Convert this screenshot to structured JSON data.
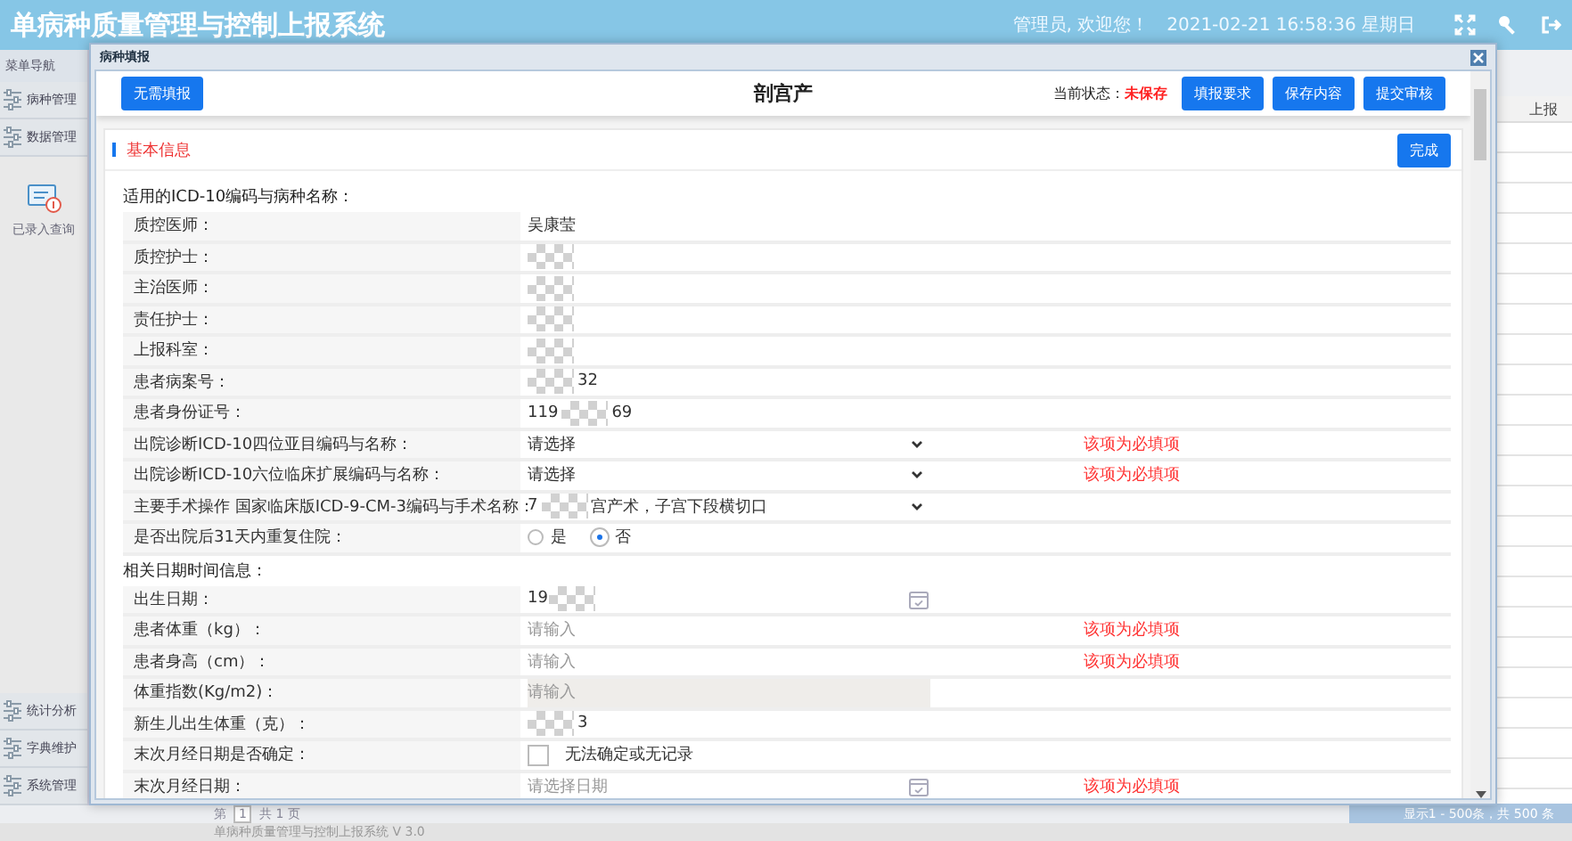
{
  "header": {
    "title": "单病种质量管理与控制上报系统",
    "welcome": "管理员, 欢迎您！",
    "datetime": "2021-02-21 16:58:36 星期日"
  },
  "sidebar": {
    "title": "菜单导航",
    "items": [
      {
        "label": "病种管理"
      },
      {
        "label": "数据管理"
      }
    ],
    "shortcut": {
      "label": "已录入查询"
    },
    "bottom_items": [
      {
        "label": "统计分析"
      },
      {
        "label": "字典维护"
      },
      {
        "label": "系统管理"
      }
    ]
  },
  "background_table": {
    "column_header": "上报"
  },
  "pager": {
    "page_label": "第",
    "page": "1",
    "total": "共 1 页",
    "summary": "显示1 - 500条，共 500 条"
  },
  "footer": "单病种质量管理与控制上报系统  V 3.0",
  "dialog": {
    "title": "病种填报",
    "toolbar": {
      "left_button": "无需填报",
      "heading": "剖宫产",
      "status_label": "当前状态：",
      "status": "未保存",
      "buttons": [
        "填报要求",
        "保存内容",
        "提交审核"
      ]
    },
    "section": {
      "title": "基本信息",
      "done_button": "完成"
    },
    "groups": [
      {
        "caption": "适用的ICD-10编码与病种名称：",
        "rows": [
          {
            "kind": "text",
            "label": "质控医师：",
            "value": "吴康莹"
          },
          {
            "kind": "text",
            "label": "质控护士：",
            "redacted": true
          },
          {
            "kind": "text",
            "label": "主治医师：",
            "redacted": true
          },
          {
            "kind": "text",
            "label": "责任护士：",
            "redacted": true
          },
          {
            "kind": "text",
            "label": "上报科室：",
            "redacted": true
          },
          {
            "kind": "text",
            "label": "患者病案号：",
            "value": "32",
            "redacted": true
          },
          {
            "kind": "text",
            "label": "患者身份证号：",
            "value": "119",
            "value_end": "69",
            "redacted": true
          },
          {
            "kind": "select",
            "label": "出院诊断ICD-10四位亚目编码与名称：",
            "value": "请选择",
            "note": "该项为必填项"
          },
          {
            "kind": "select",
            "label": "出院诊断ICD-10六位临床扩展编码与名称：",
            "value": "请选择",
            "note": "该项为必填项"
          },
          {
            "kind": "select",
            "label": "主要手术操作 国家临床版ICD-9-CM-3编码与手术名称：",
            "value": "7",
            "value_end": "宫产术，子宫下段横切口",
            "redacted": true
          },
          {
            "kind": "radio",
            "label": "是否出院后31天内重复住院：",
            "options": [
              {
                "label": "是",
                "selected": false
              },
              {
                "label": "否",
                "selected": true
              }
            ]
          }
        ]
      },
      {
        "caption": "相关日期时间信息：",
        "rows": [
          {
            "kind": "date",
            "label": "出生日期：",
            "value": "19",
            "redacted": true
          },
          {
            "kind": "input",
            "label": "患者体重（kg）：",
            "placeholder": "请输入",
            "note": "该项为必填项"
          },
          {
            "kind": "input",
            "label": "患者身高（cm）：",
            "placeholder": "请输入",
            "note": "该项为必填项"
          },
          {
            "kind": "input",
            "label": "体重指数(Kg/m2)：",
            "placeholder": "请输入",
            "disabled": true
          },
          {
            "kind": "text",
            "label": "新生儿出生体重（克）：",
            "value": "3",
            "redacted": true
          },
          {
            "kind": "checkbox",
            "label": "末次月经日期是否确定：",
            "option": "无法确定或无记录",
            "checked": false
          },
          {
            "kind": "date",
            "label": "末次月经日期：",
            "placeholder": "请选择日期",
            "note": "该项为必填项"
          }
        ]
      }
    ]
  }
}
